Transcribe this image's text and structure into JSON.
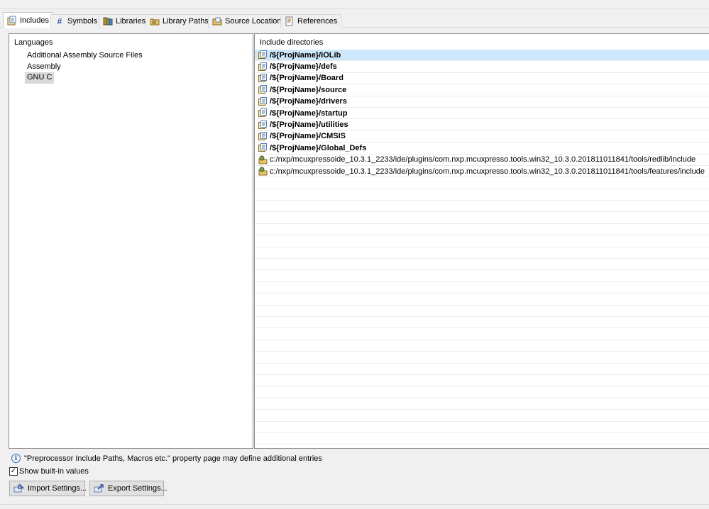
{
  "tabs": [
    {
      "label": "Includes",
      "icon": "includes-icon",
      "active": true
    },
    {
      "label": "Symbols",
      "icon": "hash-icon",
      "active": false
    },
    {
      "label": "Libraries",
      "icon": "libraries-icon",
      "active": false
    },
    {
      "label": "Library Paths",
      "icon": "library-paths-icon",
      "active": false
    },
    {
      "label": "Source Location",
      "icon": "source-location-icon",
      "active": false
    },
    {
      "label": "References",
      "icon": "references-icon",
      "active": false
    }
  ],
  "languages": {
    "title": "Languages",
    "items": [
      "Additional Assembly Source Files",
      "Assembly",
      "GNU C"
    ],
    "selected": "GNU C"
  },
  "includes": {
    "title": "Include directories",
    "items": [
      {
        "path": "/${ProjName}/IOLib",
        "kind": "workspace",
        "bold": true,
        "selected": true
      },
      {
        "path": "/${ProjName}/defs",
        "kind": "workspace",
        "bold": true
      },
      {
        "path": "/${ProjName}/Board",
        "kind": "workspace",
        "bold": true
      },
      {
        "path": "/${ProjName}/source",
        "kind": "workspace",
        "bold": true
      },
      {
        "path": "/${ProjName}/drivers",
        "kind": "workspace",
        "bold": true
      },
      {
        "path": "/${ProjName}/startup",
        "kind": "workspace",
        "bold": true
      },
      {
        "path": "/${ProjName}/utilities",
        "kind": "workspace",
        "bold": true
      },
      {
        "path": "/${ProjName}/CMSIS",
        "kind": "workspace",
        "bold": true
      },
      {
        "path": "/${ProjName}/Global_Defs",
        "kind": "workspace",
        "bold": true
      },
      {
        "path": "c:/nxp/mcuxpressoide_10.3.1_2233/ide/plugins/com.nxp.mcuxpresso.tools.win32_10.3.0.201811011841/tools/redlib/include",
        "kind": "builtin",
        "bold": false
      },
      {
        "path": "c:/nxp/mcuxpressoide_10.3.1_2233/ide/plugins/com.nxp.mcuxpresso.tools.win32_10.3.0.201811011841/tools/features/include",
        "kind": "builtin",
        "bold": false
      }
    ]
  },
  "info_text": "\"Preprocessor Include Paths, Macros etc.\" property page may define additional entries",
  "show_builtin": {
    "label": "Show built-in values",
    "checked": true
  },
  "buttons": {
    "import": "Import Settings...",
    "export": "Export Settings..."
  },
  "colors": {
    "selection": "#cde8fb",
    "panel_border": "#8c8c8c",
    "info": "#2f6fb8"
  }
}
